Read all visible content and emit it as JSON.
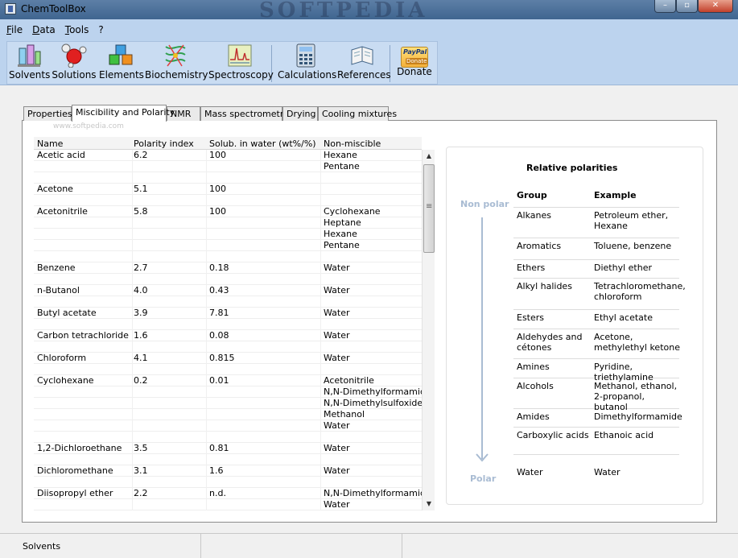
{
  "window": {
    "title": "ChemToolBox",
    "watermark": "SOFTPEDIA",
    "minimize": "–",
    "maximize": "▫",
    "close": "✕"
  },
  "menu": [
    {
      "label": "File",
      "key": "F"
    },
    {
      "label": "Data",
      "key": "D"
    },
    {
      "label": "Tools",
      "key": "T"
    },
    {
      "label": "?",
      "key": "?"
    }
  ],
  "toolbar": [
    {
      "label": "Solvents",
      "icon": "flask-icon"
    },
    {
      "label": "Solutions",
      "icon": "molecule-icon"
    },
    {
      "label": "Elements",
      "icon": "cubes-icon"
    },
    {
      "label": "Biochemistry",
      "icon": "protein-icon"
    },
    {
      "label": "Spectroscopy",
      "icon": "spectrum-icon"
    },
    {
      "label": "Calculations",
      "icon": "calculator-icon"
    },
    {
      "label": "References",
      "icon": "book-icon"
    },
    {
      "label": "Donate",
      "icon": "paypal-icon",
      "badge_top": "PayPal",
      "badge_bottom": "Donate"
    }
  ],
  "tabs": [
    "Properties",
    "Miscibility and Polarity",
    "NMR",
    "Mass spectrometry",
    "Drying",
    "Cooling mixtures"
  ],
  "active_tab": "Miscibility and Polarity",
  "ghost_text": "www.softpedia.com",
  "table": {
    "columns": [
      "Name",
      "Polarity index",
      "Solub. in water (wt%/%)",
      "Non-miscible"
    ],
    "rows": [
      [
        "Acetic acid",
        "6.2",
        "100",
        "Hexane"
      ],
      [
        "",
        "",
        "",
        "Pentane"
      ],
      [
        "",
        "",
        "",
        ""
      ],
      [
        "Acetone",
        "5.1",
        "100",
        ""
      ],
      [
        "",
        "",
        "",
        ""
      ],
      [
        "Acetonitrile",
        "5.8",
        "100",
        "Cyclohexane"
      ],
      [
        "",
        "",
        "",
        "Heptane"
      ],
      [
        "",
        "",
        "",
        "Hexane"
      ],
      [
        "",
        "",
        "",
        "Pentane"
      ],
      [
        "",
        "",
        "",
        ""
      ],
      [
        "Benzene",
        "2.7",
        "0.18",
        "Water"
      ],
      [
        "",
        "",
        "",
        ""
      ],
      [
        "n-Butanol",
        "4.0",
        "0.43",
        "Water"
      ],
      [
        "",
        "",
        "",
        ""
      ],
      [
        "Butyl acetate",
        "3.9",
        "7.81",
        "Water"
      ],
      [
        "",
        "",
        "",
        ""
      ],
      [
        "Carbon tetrachloride",
        "1.6",
        "0.08",
        "Water"
      ],
      [
        "",
        "",
        "",
        ""
      ],
      [
        "Chloroform",
        "4.1",
        "0.815",
        "Water"
      ],
      [
        "",
        "",
        "",
        ""
      ],
      [
        "Cyclohexane",
        "0.2",
        "0.01",
        "Acetonitrile"
      ],
      [
        "",
        "",
        "",
        "N,N-Dimethylformamide"
      ],
      [
        "",
        "",
        "",
        "N,N-Dimethylsulfoxide"
      ],
      [
        "",
        "",
        "",
        "Methanol"
      ],
      [
        "",
        "",
        "",
        "Water"
      ],
      [
        "",
        "",
        "",
        ""
      ],
      [
        "1,2-Dichloroethane",
        "3.5",
        "0.81",
        "Water"
      ],
      [
        "",
        "",
        "",
        ""
      ],
      [
        "Dichloromethane",
        "3.1",
        "1.6",
        "Water"
      ],
      [
        "",
        "",
        "",
        ""
      ],
      [
        "Diisopropyl ether",
        "2.2",
        "n.d.",
        "N,N-Dimethylformamide"
      ],
      [
        "",
        "",
        "",
        "Water"
      ]
    ]
  },
  "polarities": {
    "title": "Relative polarities",
    "top_label": "Non polar",
    "bottom_label": "Polar",
    "accent": "#a9bcd3",
    "headers": [
      "Group",
      "Example"
    ],
    "rows": [
      {
        "group": "Alkanes",
        "example": "Petroleum ether, Hexane",
        "lines": 2
      },
      {
        "group": "Aromatics",
        "example": "Toluene, benzene",
        "lines": 1
      },
      {
        "group": "Ethers",
        "example": "Diethyl ether",
        "lines": 1
      },
      {
        "group": "Alkyl halides",
        "example": "Tetrachloromethane, chloroform",
        "lines": 2
      },
      {
        "group": "Esters",
        "example": "Ethyl acetate",
        "lines": 1
      },
      {
        "group": "Aldehydes and cétones",
        "example": "Acetone, methylethyl ketone",
        "lines": 2
      },
      {
        "group": "Amines",
        "example": "Pyridine, triethylamine",
        "lines": 1
      },
      {
        "group": "Alcohols",
        "example": "Methanol, ethanol, 2-propanol, butanol",
        "lines": 2
      },
      {
        "group": "Amides",
        "example": "Dimethylformamide",
        "lines": 1
      },
      {
        "group": "Carboxylic acids",
        "example": "Ethanoic acid",
        "lines": 1
      },
      {
        "group": "Water",
        "example": "Water",
        "lines": 1
      }
    ]
  },
  "status": {
    "text": "Solvents"
  }
}
